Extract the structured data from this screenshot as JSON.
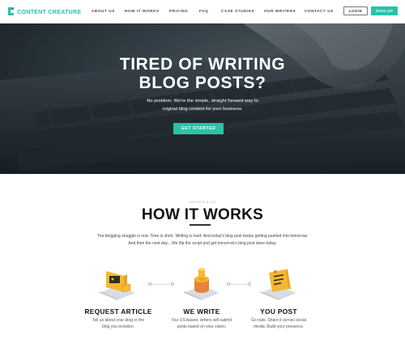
{
  "nav": {
    "logo_text": "CONTENT CREATURE",
    "links": [
      "ABOUT US",
      "HOW IT WORKS",
      "PRICING",
      "FAQ",
      "CASE STUDIES",
      "OUR WRITERS",
      "CONTACT US"
    ],
    "login_label": "LOGIN",
    "signup_label": "SIGN UP"
  },
  "hero": {
    "title_line1": "TIRED OF WRITING",
    "title_line2": "BLOG POSTS?",
    "subtitle_line1": "No problem. We're the simple, straight forward way to",
    "subtitle_line2": "original blog content for your business.",
    "cta_label": "GET STARTED"
  },
  "how": {
    "eyebrow": "THERE'S A FIX",
    "title": "HOW IT WORKS",
    "desc_line1": "The blogging struggle is real. Time is short. Writing is hard. And today's  blog post keeps getting pushed into tomorrow.",
    "desc_line2": "And then the next day... We flip the script and get tomorrow's blog post done today.",
    "steps": [
      {
        "title": "REQUEST ARTICLE",
        "desc_line1": "Tell us about your blog or the",
        "desc_line2": "blog you envision."
      },
      {
        "title": "WE WRITE",
        "desc_line1": "Our US-based, writers will submit",
        "desc_line2": "posts based on your vision."
      },
      {
        "title": "YOU POST",
        "desc_line1": "Go nuts. Share it across  social",
        "desc_line2": "media. Build your presence."
      }
    ]
  },
  "colors": {
    "accent": "#27c4a8",
    "icon_yellow": "#f5b82e",
    "icon_orange": "#e8823a",
    "icon_platform": "#d8dde3"
  },
  "icons": [
    "logo-mark-icon",
    "request-article-icon",
    "we-write-icon",
    "you-post-icon"
  ]
}
